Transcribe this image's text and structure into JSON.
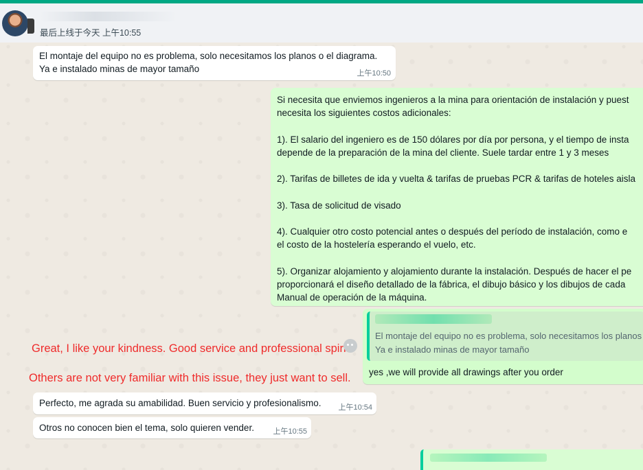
{
  "header": {
    "contact_name": "",
    "last_seen": "最后上线于今天 上午10:55"
  },
  "messages": [
    {
      "direction": "incoming",
      "text": "El montaje del equipo no es problema, solo necesitamos los planos o el diagrama.\nYa e instalado minas de mayor tamaño",
      "time": "上午10:50"
    },
    {
      "direction": "outgoing",
      "text": "Si necesita que enviemos ingenieros a la mina para orientación de instalación y puest\nnecesita los siguientes costos adicionales:\n\n1). El salario del ingeniero es de 150 dólares por día por persona, y el tiempo de insta\ndepende de la preparación de la mina del cliente. Suele tardar entre 1 y 3 meses\n\n2). Tarifas de billetes de ida y vuelta & tarifas de pruebas PCR & tarifas de hoteles aisla\n\n3). Tasa de solicitud de visado\n\n4). Cualquier otro costo potencial antes o después del período de instalación, como e\nel costo de la hostelería esperando el vuelo, etc.\n\n5). Organizar alojamiento y alojamiento durante la instalación. Después de hacer el pe\nproporcionará el diseño detallado de la fábrica, el dibujo básico y los dibujos de cada\nManual de operación de la máquina."
    },
    {
      "direction": "outgoing",
      "quoted_text": "El montaje del equipo no es problema, solo necesitamos los planos\nYa e instalado minas de mayor tamaño",
      "text": "yes ,we will provide all drawings after you order"
    },
    {
      "direction": "incoming",
      "text": "Perfecto, me agrada su amabilidad. Buen servicio y profesionalismo.",
      "time": "上午10:54"
    },
    {
      "direction": "incoming",
      "text": "Otros no conocen bien el tema, solo quieren vender.",
      "time": "上午10:55"
    }
  ],
  "annotations": [
    "Great, I like your kindness. Good service and professional spirit.",
    "Others are not very familiar with this issue, they just want to sell."
  ],
  "colors": {
    "accent": "#00a884",
    "incoming_bubble": "#ffffff",
    "outgoing_bubble": "#d9fdd3",
    "annotation": "#ef2b2b",
    "chat_background": "#efeae2"
  },
  "icons": [
    "avatar",
    "emoji-react-icon"
  ]
}
